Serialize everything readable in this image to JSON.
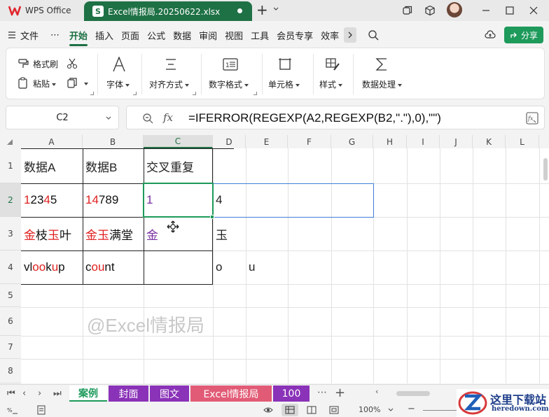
{
  "titlebar": {
    "app_name": "WPS Office",
    "doc_tab": "Excel情报局.20250622.xlsx",
    "new_tab": "+"
  },
  "menu": {
    "file": "文件",
    "more": "⋯",
    "tabs": [
      "开始",
      "插入",
      "页面",
      "公式",
      "数据",
      "审阅",
      "视图",
      "工具",
      "会员专享",
      "效率"
    ],
    "share": "分享"
  },
  "ribbon": {
    "format_painter": "格式刷",
    "paste": "粘贴",
    "font": "字体",
    "align": "对齐方式",
    "number_format": "数字格式",
    "cell": "单元格",
    "style": "样式",
    "data_process": "数据处理"
  },
  "formula_bar": {
    "name_box": "C2",
    "fx": "fx",
    "formula": "=IFERROR(REGEXP(A2,REGEXP(B2,\".\"),0),\"\")"
  },
  "columns": [
    "A",
    "B",
    "C",
    "D",
    "E",
    "F",
    "G",
    "H",
    "I",
    "J",
    "K",
    "L"
  ],
  "rows": [
    "1",
    "2",
    "3",
    "4",
    "5",
    "6",
    "7",
    "8"
  ],
  "cells": {
    "A1": "数据A",
    "B1": "数据B",
    "C1": "交叉重复",
    "A2_parts": [
      {
        "t": "1",
        "c": "red"
      },
      {
        "t": "2",
        "c": "black"
      },
      {
        "t": "3",
        "c": "black"
      },
      {
        "t": "4",
        "c": "red"
      },
      {
        "t": "5",
        "c": "black"
      }
    ],
    "B2_parts": [
      {
        "t": "14",
        "c": "red"
      },
      {
        "t": "789",
        "c": "black"
      }
    ],
    "C2": "1",
    "D2": "4",
    "A3_parts": [
      {
        "t": "金",
        "c": "red"
      },
      {
        "t": "枝",
        "c": "black"
      },
      {
        "t": "玉",
        "c": "red"
      },
      {
        "t": "叶",
        "c": "black"
      }
    ],
    "B3_parts": [
      {
        "t": "金玉",
        "c": "red"
      },
      {
        "t": "满堂",
        "c": "black"
      }
    ],
    "C3": "金",
    "D3": "玉",
    "A4_parts": [
      {
        "t": "vl",
        "c": "black"
      },
      {
        "t": "oo",
        "c": "red"
      },
      {
        "t": "k",
        "c": "black"
      },
      {
        "t": "u",
        "c": "red"
      },
      {
        "t": "p",
        "c": "black"
      }
    ],
    "B4_parts": [
      {
        "t": "c",
        "c": "black"
      },
      {
        "t": "ou",
        "c": "red"
      },
      {
        "t": "nt",
        "c": "black"
      }
    ],
    "D4": "o",
    "E4": "u"
  },
  "watermark": "@Excel情报局",
  "sheet_tabs": [
    {
      "label": "案例",
      "active": true
    },
    {
      "label": "封面"
    },
    {
      "label": "图文"
    },
    {
      "label": "Excel情报局"
    },
    {
      "label": "100"
    }
  ],
  "status": {
    "zoom": "100%",
    "brand_text": "这里下载站",
    "brand_url": "heredown.com"
  },
  "colors": {
    "accent": "#1e7145",
    "red_text": "#e02020",
    "purple_text": "#7a2fa0",
    "tab_purple": "#8a32b8",
    "tab_pink": "#e25b76"
  }
}
